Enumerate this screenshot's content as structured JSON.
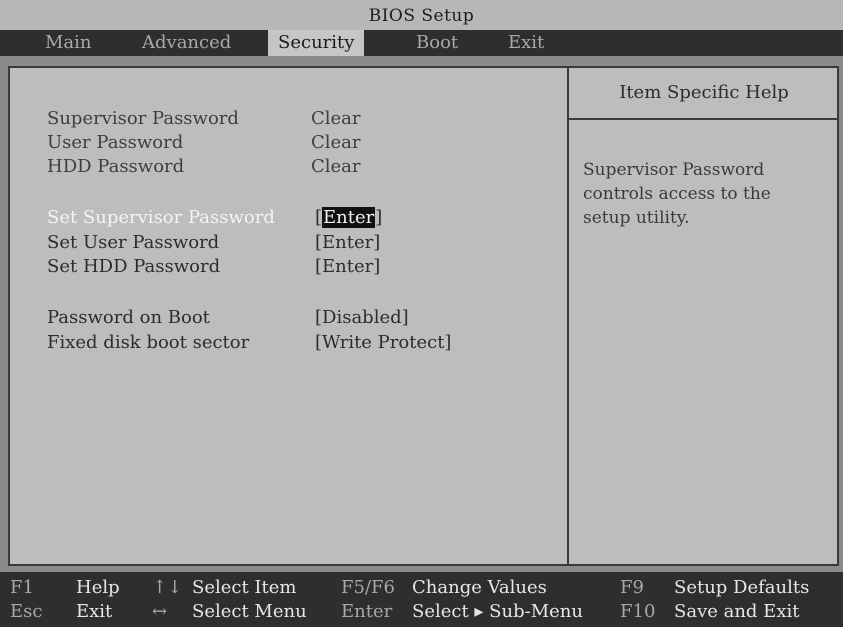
{
  "window": {
    "title": "BIOS Setup"
  },
  "menu": {
    "tabs": [
      {
        "label": "Main"
      },
      {
        "label": "Advanced"
      },
      {
        "label": "Security"
      },
      {
        "label": "Boot"
      },
      {
        "label": "Exit"
      }
    ],
    "active_tab": "Security"
  },
  "security": {
    "status_rows": [
      {
        "label": "Supervisor Password",
        "value": "Clear"
      },
      {
        "label": "User Password",
        "value": "Clear"
      },
      {
        "label": "HDD Password",
        "value": "Clear"
      }
    ],
    "set_rows": [
      {
        "label": "Set Supervisor Password",
        "value": "Enter",
        "bracket_open": "[",
        "bracket_close": "]"
      },
      {
        "label": "Set User Password",
        "value": "[Enter]"
      },
      {
        "label": "Set HDD Password",
        "value": "[Enter]"
      }
    ],
    "option_rows": [
      {
        "label": "Password on Boot",
        "value": "[Disabled]"
      },
      {
        "label": "Fixed disk boot sector",
        "value": "[Write Protect]"
      }
    ]
  },
  "help": {
    "title": "Item Specific Help",
    "text": "Supervisor Password\ncontrols access to the\nsetup utility."
  },
  "footer": {
    "keys": [
      {
        "key": "F1",
        "desc": "Help"
      },
      {
        "key": "Esc",
        "desc": "Exit"
      },
      {
        "key": "↑↓",
        "desc": "Select Item"
      },
      {
        "key": "↔",
        "desc": "Select Menu"
      },
      {
        "key": "F5/F6",
        "desc": "Change Values"
      },
      {
        "key": "Enter",
        "desc": "Select ▸ Sub-Menu"
      },
      {
        "key": "F9",
        "desc": "Setup Defaults"
      },
      {
        "key": "F10",
        "desc": "Save and Exit"
      }
    ]
  }
}
